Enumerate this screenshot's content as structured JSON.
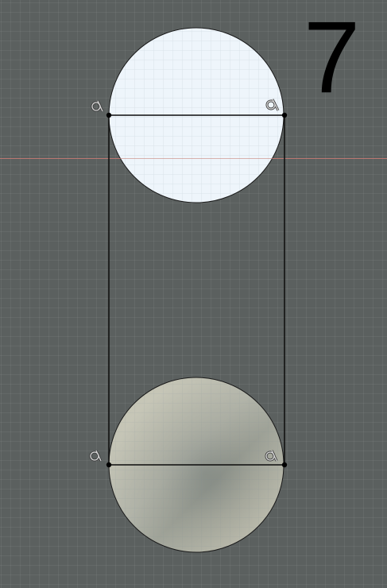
{
  "step_label": "7",
  "colors": {
    "canvas_background": "#5b605f",
    "grid_line": "rgba(255,255,255,0.055)",
    "x_axis": "#b56a64",
    "top_circle_fill": "#eef5fb",
    "bottom_circle_fill": "#c9c8b6",
    "sketch_line": "#0c0c0c",
    "constraint_icon": "#d2d2d2"
  },
  "icons": {
    "constraint_glyph": "coincident-constraint-icon"
  }
}
